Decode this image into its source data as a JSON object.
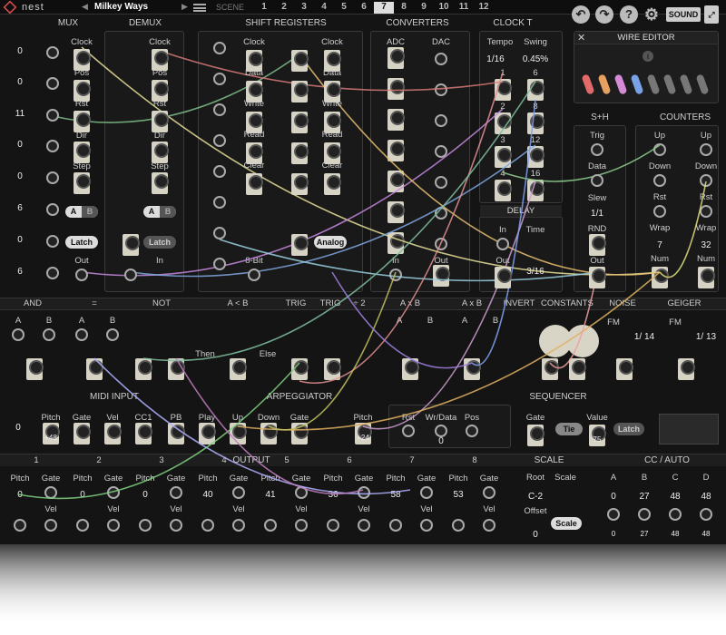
{
  "topbar": {
    "brand": "nest",
    "preset": "Milkey Ways",
    "scene_label": "SCENE",
    "scenes": [
      "1",
      "2",
      "3",
      "4",
      "5",
      "6",
      "7",
      "8",
      "9",
      "10",
      "11",
      "12"
    ],
    "active_scene": "7",
    "sound": "SOUND"
  },
  "mux": {
    "title": "MUX",
    "values": [
      "0",
      "0",
      "11",
      "0",
      "0",
      "6",
      "0",
      "6"
    ],
    "ab": [
      "A",
      "B"
    ]
  },
  "demux": {
    "title": "DEMUX",
    "labels": [
      "Clock",
      "Pos",
      "Rst",
      "Dir",
      "Step",
      "Out",
      "In"
    ],
    "latch": "Latch",
    "latch2": "Latch"
  },
  "shift": {
    "title": "SHIFT REGISTERS",
    "labels_l": [
      "Clock",
      "Data",
      "Write",
      "Read",
      "Clear",
      "8-Bit"
    ],
    "labels_r": [
      "Clock",
      "Data",
      "Write",
      "Read",
      "Clear"
    ],
    "analog": "Analog"
  },
  "conv": {
    "title": "CONVERTERS",
    "adc": "ADC",
    "dac": "DAC",
    "in": "In",
    "out": "Out"
  },
  "clock": {
    "title": "CLOCK T",
    "tempo": "Tempo",
    "swing": "Swing",
    "tempo_val": "1/16",
    "swing_val": "0.45%",
    "divs": [
      "1",
      "2",
      "3",
      "4",
      "6",
      "8",
      "12",
      "16"
    ]
  },
  "wire_editor": {
    "title": "WIRE EDITOR"
  },
  "delay": {
    "title": "DELAY",
    "in": "In",
    "time": "Time",
    "out": "Out",
    "time_val": "3/16"
  },
  "sh": {
    "title": "S+H",
    "trig": "Trig",
    "data": "Data",
    "slew": "Slew",
    "slew_val": "1/1",
    "rnd": "RND",
    "out": "Out"
  },
  "counters": {
    "title": "COUNTERS",
    "up": "Up",
    "down": "Down",
    "rst": "Rst",
    "wrap": "Wrap",
    "num": "Num",
    "wrap1": "7",
    "wrap2": "32"
  },
  "logic_row": {
    "labels": [
      "AND",
      "=",
      "NOT",
      "A < B",
      "TRIG",
      "TRIG",
      "÷ 2",
      "A x B",
      "A x B",
      "INVERT",
      "CONSTANTS",
      "NOISE",
      "GEIGER"
    ],
    "ab": [
      "A",
      "B"
    ],
    "then": "Then",
    "else": "Else",
    "fm": "FM",
    "fm1": "1/ 14",
    "fm2": "1/ 13"
  },
  "midi": {
    "title": "MIDI INPUT",
    "labels": [
      "Pitch",
      "Gate",
      "Vel",
      "CC1",
      "PB",
      "Play"
    ],
    "pitch_val": "+48",
    "value0": "0"
  },
  "arp": {
    "title": "ARPEGGIATOR",
    "labels": [
      "Up",
      "Down",
      "Gate",
      "Pitch"
    ],
    "pitch_val": "+24"
  },
  "seq": {
    "title": "SEQUENCER",
    "labels": [
      "Rst",
      "Wr/Data",
      "Pos",
      "Gate",
      "Value"
    ],
    "tie": "Tie",
    "latch": "Latch",
    "pos_val": "0",
    "value_val": "75"
  },
  "output": {
    "title": "OUTPUT",
    "channels": [
      "1",
      "2",
      "3",
      "4",
      "5",
      "6",
      "7",
      "8"
    ],
    "pitch": "Pitch",
    "gate": "Gate",
    "vel": "Vel",
    "values": [
      "0",
      "0",
      "0",
      "40",
      "41",
      "36",
      "58",
      "53"
    ]
  },
  "scale": {
    "title": "SCALE",
    "root": "Root",
    "scale": "Scale",
    "root_val": "C-2",
    "offset": "Offset",
    "offset_val": "0",
    "button": "Scale"
  },
  "cc": {
    "title": "CC / AUTO",
    "labels": [
      "A",
      "B",
      "C",
      "D"
    ],
    "values": [
      "0",
      "27",
      "48",
      "48"
    ],
    "bottom": [
      "0",
      "27",
      "48",
      "48"
    ]
  }
}
